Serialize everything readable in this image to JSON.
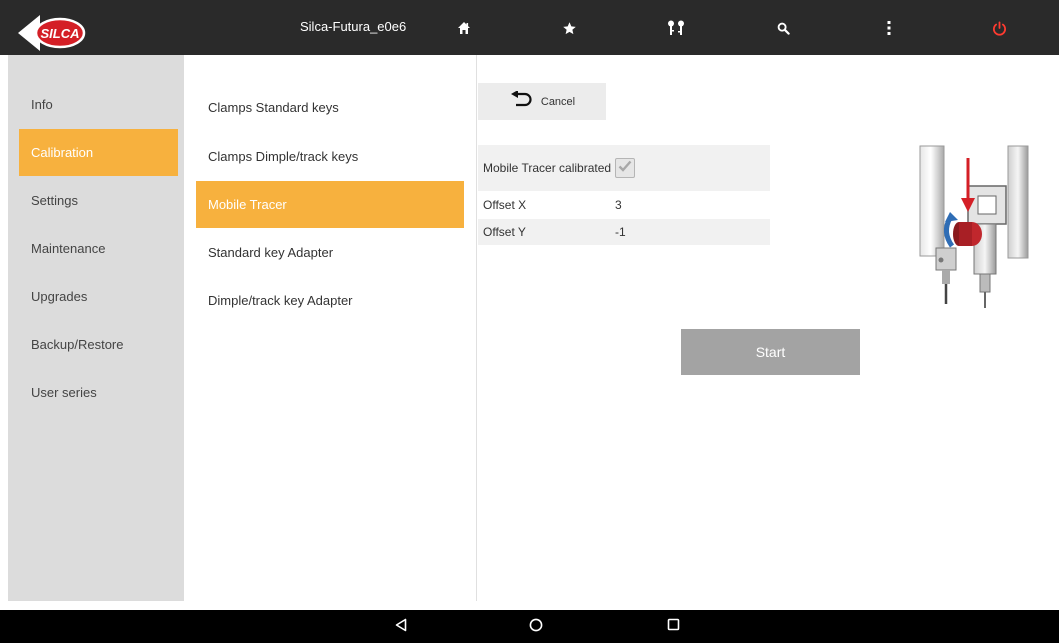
{
  "topbar": {
    "brand": "SILCA",
    "device_name": "Silca-Futura_e0e6",
    "icons": [
      "home-icon",
      "star-icon",
      "keys-icon",
      "search-icon",
      "more-vert-icon",
      "power-icon"
    ],
    "colors": {
      "background": "#2a2a2a",
      "power": "#ff3b30",
      "logo_red": "#d41f26"
    }
  },
  "sidebar": {
    "items": [
      {
        "label": "Info",
        "active": false
      },
      {
        "label": "Calibration",
        "active": true
      },
      {
        "label": "Settings",
        "active": false
      },
      {
        "label": "Maintenance",
        "active": false
      },
      {
        "label": "Upgrades",
        "active": false
      },
      {
        "label": "Backup/Restore",
        "active": false
      },
      {
        "label": "User series",
        "active": false
      }
    ]
  },
  "calibration_list": {
    "items": [
      {
        "label": "Clamps Standard keys",
        "active": false
      },
      {
        "label": "Clamps Dimple/track keys",
        "active": false
      },
      {
        "label": "Mobile Tracer",
        "active": true
      },
      {
        "label": "Standard key Adapter",
        "active": false
      },
      {
        "label": "Dimple/track key Adapter",
        "active": false
      }
    ]
  },
  "actions": {
    "cancel_label": "Cancel",
    "cancel_icon": "undo-arrow-icon",
    "start_label": "Start"
  },
  "status_table": {
    "rows": [
      {
        "label": "Mobile Tracer calibrated",
        "value": "",
        "checked": true
      },
      {
        "label": "Offset X",
        "value": "3"
      },
      {
        "label": "Offset Y",
        "value": "-1"
      }
    ]
  },
  "accent_color": "#f7b13e",
  "nav": {
    "icons": [
      "back-icon",
      "home-circle-icon",
      "recents-icon"
    ]
  }
}
